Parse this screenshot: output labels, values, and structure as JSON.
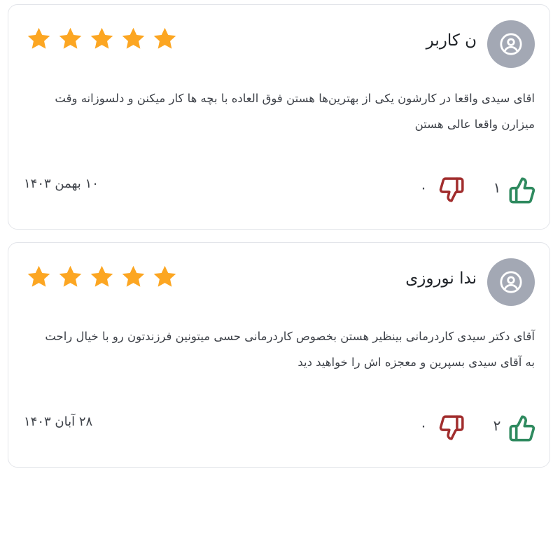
{
  "reviews": [
    {
      "name": "ن کاربر",
      "rating": 5,
      "text": "اقای سیدی واقعا در کارشون یکی از بهترین‌ها هستن فوق العاده با بچه ها کار میکنن و دلسوزانه وقت میزارن واقعا عالی هستن",
      "date": "۱۰ بهمن ۱۴۰۳",
      "likes": "۱",
      "dislikes": "۰"
    },
    {
      "name": "ندا نوروزی",
      "rating": 5,
      "text": "آقای دکتر سیدی کاردرمانی بینظیر هستن بخصوص کاردرمانی حسی میتونین فرزندتون رو با خیال راحت به آقای سیدی بسپرین و معجزه اش را خواهید دید",
      "date": "۲۸ آبان ۱۴۰۳",
      "likes": "۲",
      "dislikes": "۰"
    }
  ],
  "colors": {
    "star": "#fca622",
    "like": "#2f8a5f",
    "dislike": "#a12d2d",
    "avatar_bg": "#a3a8b4",
    "border": "#e3e5ea"
  },
  "icons": {
    "avatar": "user-circle-icon",
    "star": "star-icon",
    "like": "thumbs-up-icon",
    "dislike": "thumbs-down-icon"
  }
}
